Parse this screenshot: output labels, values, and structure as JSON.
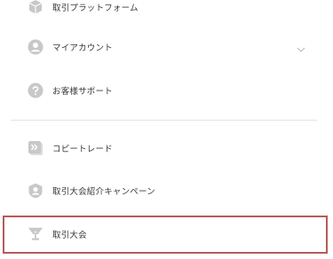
{
  "menu": {
    "items": [
      {
        "label": "取引プラットフォーム",
        "icon": "box-icon"
      },
      {
        "label": "マイアカウント",
        "icon": "user-icon"
      },
      {
        "label": "お客様サポート",
        "icon": "help-icon"
      },
      {
        "label": "コピートレード",
        "icon": "copy-trade-icon"
      },
      {
        "label": "取引大会紹介キャンペーン",
        "icon": "shield-user-icon"
      },
      {
        "label": "取引大会",
        "icon": "trophy-icon"
      }
    ]
  },
  "colors": {
    "icon_gray": "#c8c8c8",
    "highlight_border": "#b65a5a",
    "text": "#3a3a3a"
  }
}
